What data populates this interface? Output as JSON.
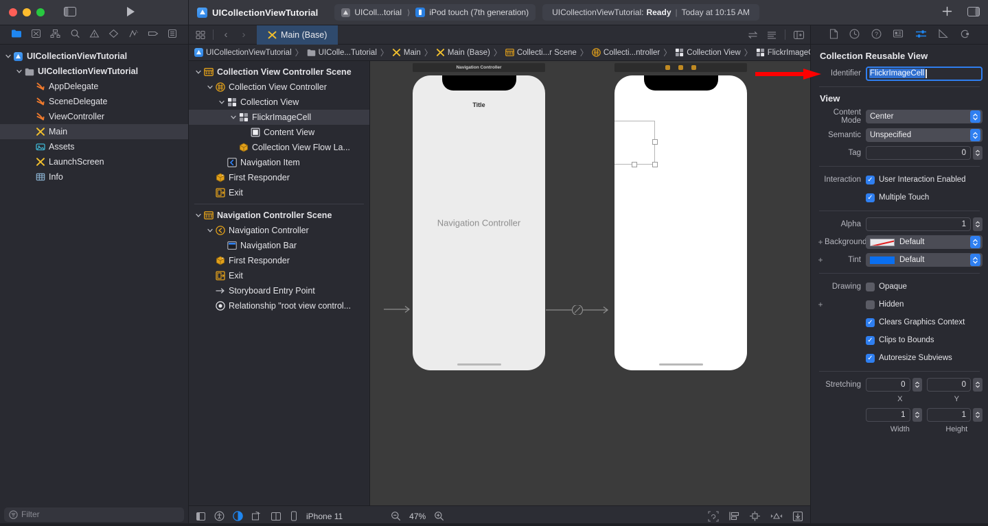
{
  "titlebar": {
    "project_name": "UICollectionViewTutorial",
    "scheme": "UIColl...torial",
    "destination": "iPod touch (7th generation)",
    "status_prefix": "UICollectionViewTutorial:",
    "status_state": "Ready",
    "status_time": "Today at 10:15 AM",
    "status_bar_sep": "|",
    "add_label": "+",
    "icons": {
      "sidebar_toggle": "sidebar-toggle-icon",
      "run": "run-icon",
      "inspector_toggle": "inspector-toggle-icon"
    }
  },
  "navigator": {
    "toolbar_icons": [
      {
        "name": "project-navigator-icon",
        "active": true
      },
      {
        "name": "source-control-navigator-icon",
        "active": false
      },
      {
        "name": "hierarchy-navigator-icon",
        "active": false
      },
      {
        "name": "find-navigator-icon",
        "active": false
      },
      {
        "name": "issue-navigator-icon",
        "active": false
      },
      {
        "name": "test-navigator-icon",
        "active": false
      },
      {
        "name": "debug-navigator-icon",
        "active": false
      },
      {
        "name": "breakpoint-navigator-icon",
        "active": false
      },
      {
        "name": "report-navigator-icon",
        "active": false
      }
    ],
    "tree": [
      {
        "label": "UICollectionViewTutorial",
        "indent": 0,
        "twisty": "open",
        "icon": "xcode-project-icon",
        "bold": true,
        "selected": false
      },
      {
        "label": "UICollectionViewTutorial",
        "indent": 1,
        "twisty": "open",
        "icon": "folder-icon",
        "bold": true,
        "selected": false
      },
      {
        "label": "AppDelegate",
        "indent": 2,
        "twisty": "none",
        "icon": "swift-file-icon",
        "bold": false,
        "selected": false
      },
      {
        "label": "SceneDelegate",
        "indent": 2,
        "twisty": "none",
        "icon": "swift-file-icon",
        "bold": false,
        "selected": false
      },
      {
        "label": "ViewController",
        "indent": 2,
        "twisty": "none",
        "icon": "swift-file-icon",
        "bold": false,
        "selected": false
      },
      {
        "label": "Main",
        "indent": 2,
        "twisty": "none",
        "icon": "storyboard-icon",
        "bold": false,
        "selected": true
      },
      {
        "label": "Assets",
        "indent": 2,
        "twisty": "none",
        "icon": "assets-icon",
        "bold": false,
        "selected": false
      },
      {
        "label": "LaunchScreen",
        "indent": 2,
        "twisty": "none",
        "icon": "storyboard-icon",
        "bold": false,
        "selected": false
      },
      {
        "label": "Info",
        "indent": 2,
        "twisty": "none",
        "icon": "plist-icon",
        "bold": false,
        "selected": false
      }
    ],
    "filter_placeholder": "Filter",
    "filter_value": ""
  },
  "editor": {
    "tab_label": "Main (Base)",
    "tab_icon": "storyboard-icon",
    "back_label": "‹",
    "forward_label": "›",
    "breadcrumb": [
      {
        "label": "UICollectionViewTutorial",
        "icon": "xcode-project-icon"
      },
      {
        "label": "UIColle...Tutorial",
        "icon": "folder-icon"
      },
      {
        "label": "Main",
        "icon": "storyboard-icon"
      },
      {
        "label": "Main (Base)",
        "icon": "storyboard-icon"
      },
      {
        "label": "Collecti...r Scene",
        "icon": "scene-icon"
      },
      {
        "label": "Collecti...ntroller",
        "icon": "collection-view-controller-icon"
      },
      {
        "label": "Collection View",
        "icon": "collection-view-icon"
      },
      {
        "label": "FlickrImageCell",
        "icon": "collection-view-cell-icon"
      }
    ],
    "separator": "〉"
  },
  "outline": {
    "items": [
      {
        "label": "Collection View Controller Scene",
        "indent": 0,
        "twisty": "open",
        "icon": "scene-icon",
        "bold": true,
        "selected": false
      },
      {
        "label": "Collection View Controller",
        "indent": 1,
        "twisty": "open",
        "icon": "collection-view-controller-icon",
        "bold": false,
        "selected": false
      },
      {
        "label": "Collection View",
        "indent": 2,
        "twisty": "open",
        "icon": "collection-view-icon",
        "bold": false,
        "selected": false
      },
      {
        "label": "FlickrImageCell",
        "indent": 3,
        "twisty": "open",
        "icon": "collection-view-cell-icon",
        "bold": false,
        "selected": true
      },
      {
        "label": "Content View",
        "indent": 4,
        "twisty": "none",
        "icon": "view-icon",
        "bold": false,
        "selected": false
      },
      {
        "label": "Collection View Flow La...",
        "indent": 3,
        "twisty": "none",
        "icon": "flow-layout-icon",
        "bold": false,
        "selected": false
      },
      {
        "label": "Navigation Item",
        "indent": 2,
        "twisty": "none",
        "icon": "navigation-item-icon",
        "bold": false,
        "selected": false
      },
      {
        "label": "First Responder",
        "indent": 1,
        "twisty": "none",
        "icon": "first-responder-icon",
        "bold": false,
        "selected": false
      },
      {
        "label": "Exit",
        "indent": 1,
        "twisty": "none",
        "icon": "exit-icon",
        "bold": false,
        "selected": false
      },
      {
        "label": "Navigation Controller Scene",
        "indent": 0,
        "twisty": "open",
        "icon": "scene-icon",
        "bold": true,
        "selected": false,
        "divider_above": true
      },
      {
        "label": "Navigation Controller",
        "indent": 1,
        "twisty": "open",
        "icon": "navigation-controller-icon",
        "bold": false,
        "selected": false
      },
      {
        "label": "Navigation Bar",
        "indent": 2,
        "twisty": "none",
        "icon": "navigation-bar-icon",
        "bold": false,
        "selected": false
      },
      {
        "label": "First Responder",
        "indent": 1,
        "twisty": "none",
        "icon": "first-responder-icon",
        "bold": false,
        "selected": false
      },
      {
        "label": "Exit",
        "indent": 1,
        "twisty": "none",
        "icon": "exit-icon",
        "bold": false,
        "selected": false
      },
      {
        "label": "Storyboard Entry Point",
        "indent": 1,
        "twisty": "none",
        "icon": "entry-point-icon",
        "bold": false,
        "selected": false
      },
      {
        "label": "Relationship \"root view control...",
        "indent": 1,
        "twisty": "none",
        "icon": "relationship-icon",
        "bold": false,
        "selected": false
      }
    ]
  },
  "canvas": {
    "scene_nav": {
      "bar_title": "Navigation Controller",
      "phone_title": "Title",
      "vc_label": "Navigation Controller"
    },
    "scene_collection": {
      "dock_icons": [
        "view-controller-dock-icon",
        "first-responder-dock-icon",
        "exit-dock-icon"
      ]
    },
    "bottom_bar": {
      "device_label": "iPhone 11",
      "zoom_level": "47%",
      "icons_left": [
        {
          "name": "document-outline-toggle-icon",
          "active": false
        },
        {
          "name": "accessibility-inspector-icon",
          "active": false
        },
        {
          "name": "appearance-toggle-icon",
          "active": true
        },
        {
          "name": "orientation-icon",
          "active": false
        },
        {
          "name": "variants-icon",
          "active": false
        },
        {
          "name": "device-icon",
          "active": false
        }
      ],
      "zoom_out_icon": "zoom-out-icon",
      "zoom_in_icon": "zoom-in-icon",
      "icons_right": [
        {
          "name": "update-frames-icon"
        },
        {
          "name": "embed-in-icon"
        },
        {
          "name": "align-icon"
        },
        {
          "name": "add-constraints-icon"
        },
        {
          "name": "resolve-auto-layout-icon"
        }
      ]
    }
  },
  "inspector": {
    "tabs": [
      {
        "name": "file-inspector-icon",
        "active": false
      },
      {
        "name": "history-inspector-icon",
        "active": false
      },
      {
        "name": "help-inspector-icon",
        "active": false
      },
      {
        "name": "identity-inspector-icon",
        "active": false
      },
      {
        "name": "attributes-inspector-icon",
        "active": true
      },
      {
        "name": "size-inspector-icon",
        "active": false
      },
      {
        "name": "connections-inspector-icon",
        "active": false
      }
    ],
    "section_reusable": {
      "title": "Collection Reusable View",
      "identifier_label": "Identifier",
      "identifier_value": "FlickrImageCell"
    },
    "section_view": {
      "title": "View",
      "content_mode_label": "Content Mode",
      "content_mode_value": "Center",
      "semantic_label": "Semantic",
      "semantic_value": "Unspecified",
      "tag_label": "Tag",
      "tag_value": "0",
      "interaction_label": "Interaction",
      "interaction_user_enabled": {
        "label": "User Interaction Enabled",
        "checked": true
      },
      "interaction_multiple_touch": {
        "label": "Multiple Touch",
        "checked": true
      },
      "alpha_label": "Alpha",
      "alpha_value": "1",
      "background_label": "Background",
      "background_value": "Default",
      "tint_label": "Tint",
      "tint_value": "Default",
      "drawing_label": "Drawing",
      "drawing_opaque": {
        "label": "Opaque",
        "checked": false
      },
      "drawing_hidden": {
        "label": "Hidden",
        "checked": false
      },
      "drawing_clears_graphics": {
        "label": "Clears Graphics Context",
        "checked": true
      },
      "drawing_clips_bounds": {
        "label": "Clips to Bounds",
        "checked": true
      },
      "drawing_autoresize": {
        "label": "Autoresize Subviews",
        "checked": true
      },
      "stretching_label": "Stretching",
      "stretch_x": "0",
      "stretch_x_caption": "X",
      "stretch_y": "0",
      "stretch_y_caption": "Y",
      "stretch_w": "1",
      "stretch_w_caption": "Width",
      "stretch_h": "1",
      "stretch_h_caption": "Height"
    }
  },
  "annotation": {
    "arrow_name": "red-pointer-arrow",
    "arrow_color": "#ff0000"
  }
}
